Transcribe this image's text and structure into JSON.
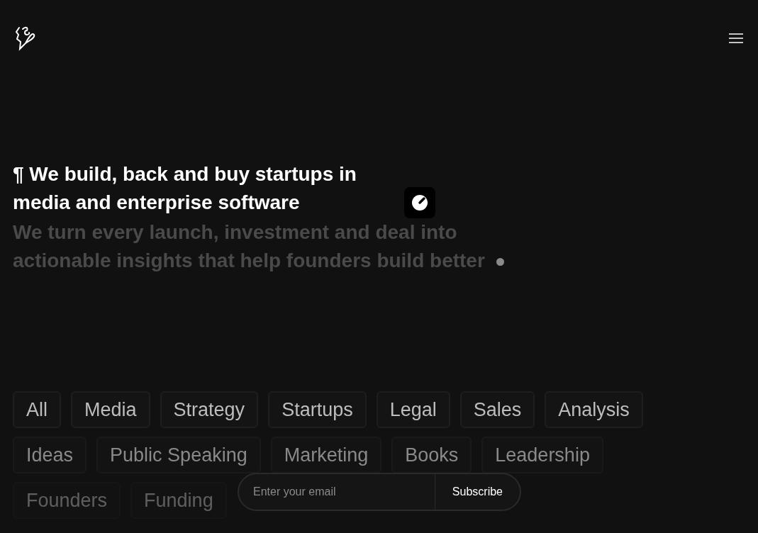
{
  "headline": "¶ We build, back and buy startups in media and enterprise software",
  "subline": "We turn every launch, investment and deal into actionable insights that help founders build better",
  "tag_rows": [
    {
      "tags": [
        "All",
        "Media",
        "Strategy",
        "Startups",
        "Legal",
        "Sales",
        "Analysis"
      ]
    },
    {
      "tags": [
        "Ideas",
        "Public Speaking",
        "Marketing",
        "Books",
        "Leadership"
      ]
    },
    {
      "tags": [
        "Founders",
        "Funding"
      ]
    }
  ],
  "subscribe": {
    "placeholder": "Enter your email",
    "button": "Subscribe"
  }
}
